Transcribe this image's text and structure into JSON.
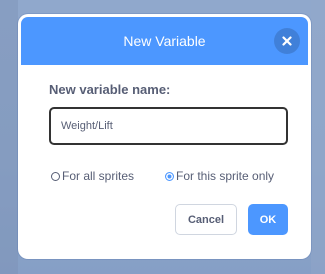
{
  "dialog": {
    "title": "New Variable",
    "close_icon": "close-icon",
    "name_label": "New variable name:",
    "name_input_value": "Weight/Lift",
    "scope_options": [
      {
        "label": "For all sprites",
        "selected": false
      },
      {
        "label": "For this sprite only",
        "selected": true
      }
    ],
    "cancel_label": "Cancel",
    "ok_label": "OK"
  },
  "colors": {
    "header": "#4c97ff",
    "accent": "#4c97ff",
    "text": "#575e75",
    "backdrop": "#8aa3c9"
  }
}
